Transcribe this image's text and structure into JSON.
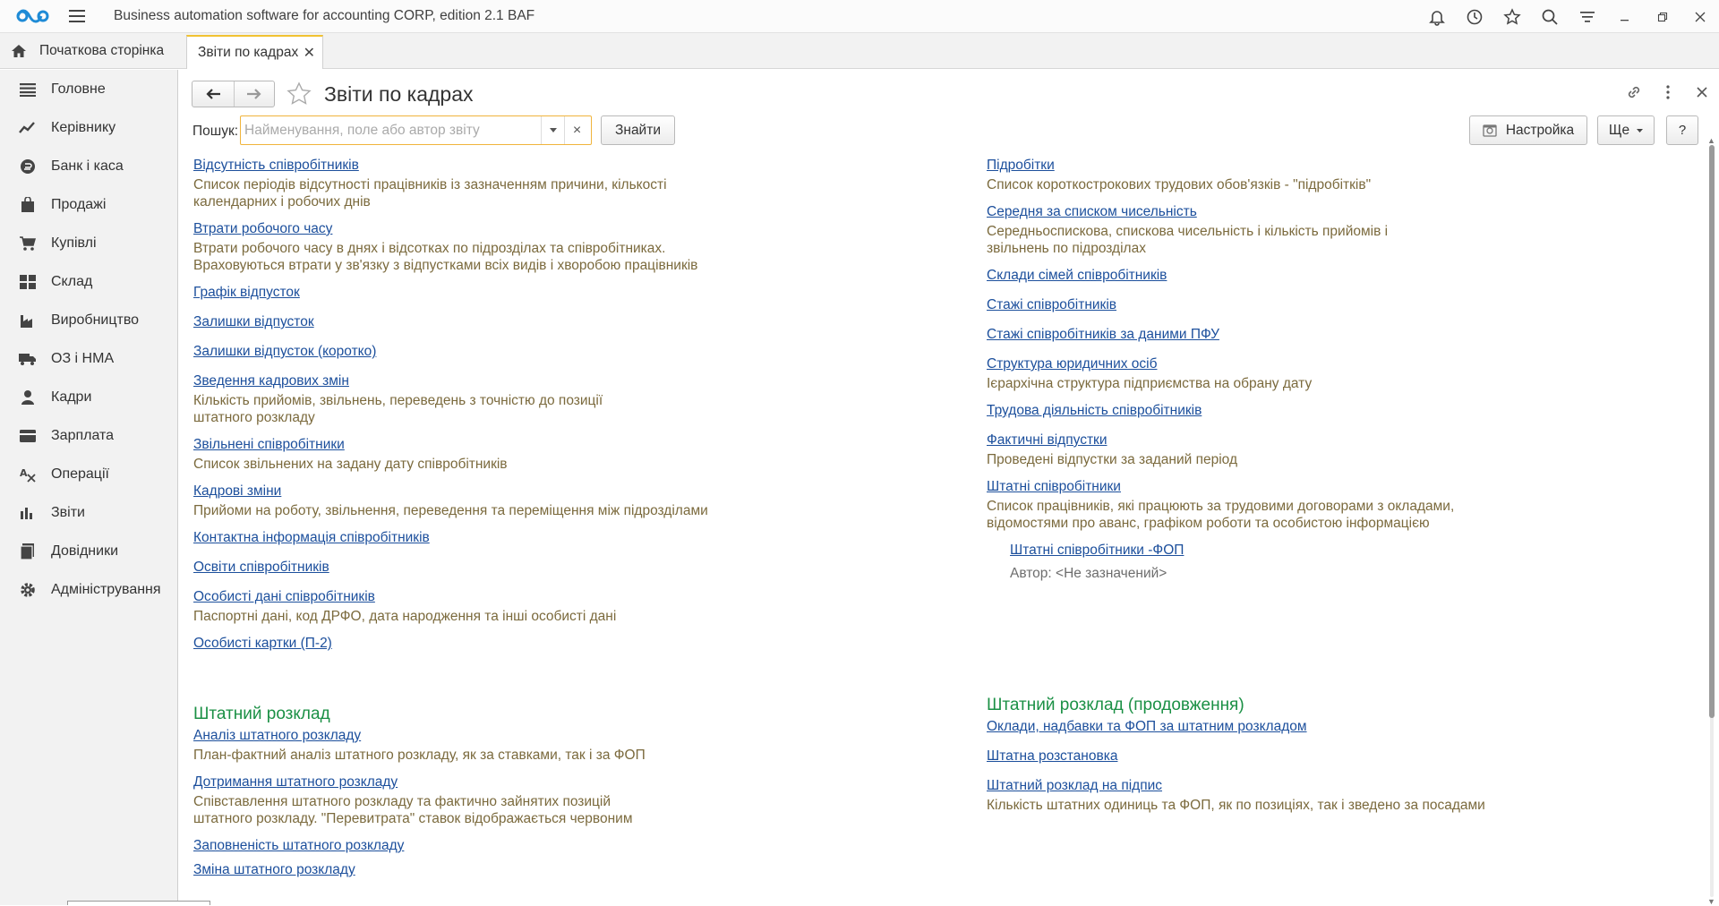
{
  "app": {
    "title": "Business automation software for accounting CORP, edition 2.1 BAF"
  },
  "tabs": {
    "home_label": "Початкова сторінка",
    "active_label": "Звіти по кадрах",
    "close_glyph": "✕"
  },
  "sidebar": {
    "items": [
      {
        "label": "Головне",
        "icon": "list-icon"
      },
      {
        "label": "Керівнику",
        "icon": "trend-icon"
      },
      {
        "label": "Банк і каса",
        "icon": "coin-icon"
      },
      {
        "label": "Продажі",
        "icon": "bag-icon"
      },
      {
        "label": "Купівлі",
        "icon": "cart-icon"
      },
      {
        "label": "Склад",
        "icon": "warehouse-icon"
      },
      {
        "label": "Виробництво",
        "icon": "factory-icon"
      },
      {
        "label": "ОЗ і НМА",
        "icon": "truck-icon"
      },
      {
        "label": "Кадри",
        "icon": "person-icon"
      },
      {
        "label": "Зарплата",
        "icon": "wallet-icon"
      },
      {
        "label": "Операції",
        "icon": "operations-icon"
      },
      {
        "label": "Звіти",
        "icon": "bar-chart-icon"
      },
      {
        "label": "Довідники",
        "icon": "book-icon"
      },
      {
        "label": "Адміністрування",
        "icon": "gear-icon"
      }
    ]
  },
  "form": {
    "title": "Звіти по кадрах",
    "search_label": "Пошук:",
    "search_placeholder": "Найменування, поле або автор звіту",
    "search_value": "",
    "find_button": "Знайти",
    "settings_button": "Настройка",
    "more_button": "Ще",
    "help_button": "?",
    "clear_glyph": "×"
  },
  "reports_left": [
    {
      "title": "Відсутність співробітників",
      "desc": [
        "Список періодів відсутності працівників із зазначенням причини, кількості",
        "календарних і робочих днів"
      ]
    },
    {
      "title": "Втрати робочого часу",
      "desc": [
        "Втрати робочого часу в днях і відсотках по підрозділах та співробітниках.",
        "Враховуються втрати у зв'язку з відпустками всіх видів і хворобою працівників"
      ]
    },
    {
      "title": "Графік відпусток",
      "desc": []
    },
    {
      "title": "Залишки відпусток",
      "desc": []
    },
    {
      "title": "Залишки відпусток (коротко)",
      "desc": []
    },
    {
      "title": "Зведення кадрових змін",
      "desc": [
        "Кількість прийомів, звільнень, переведень з точністю до позиції",
        "штатного розкладу"
      ]
    },
    {
      "title": "Звільнені співробітники",
      "desc": [
        "Список звільнених на задану дату співробітників"
      ]
    },
    {
      "title": "Кадрові зміни",
      "desc": [
        "Прийоми на роботу, звільнення, переведення та переміщення між підрозділами"
      ]
    },
    {
      "title": "Контактна інформація співробітників",
      "desc": []
    },
    {
      "title": "Освіти співробітників",
      "desc": []
    },
    {
      "title": "Особисті дані співробітників",
      "desc": [
        "Паспортні дані, код ДРФО, дата народження та інші особисті дані"
      ]
    },
    {
      "title": "Особисті картки (П-2)",
      "desc": []
    }
  ],
  "reports_right": [
    {
      "title": "Підробітки",
      "desc": [
        "Список короткострокових трудових обов'язків - \"підробітків\""
      ]
    },
    {
      "title": "Середня за списком чисельність",
      "desc": [
        "Середньоспискова, спискова чисельність і кількість прийомів і",
        "звільнень по підрозділах"
      ]
    },
    {
      "title": "Склади сімей співробітників",
      "desc": []
    },
    {
      "title": "Стажі співробітників",
      "desc": []
    },
    {
      "title": "Стажі співробітників за даними ПФУ",
      "desc": []
    },
    {
      "title": "Структура юридичних осіб",
      "desc": [
        "Ієрархічна структура підприємства на обрану дату"
      ]
    },
    {
      "title": "Трудова діяльність співробітників",
      "desc": []
    },
    {
      "title": "Фактичні відпустки",
      "desc": [
        "Проведені відпустки за заданий період"
      ]
    },
    {
      "title": "Штатні співробітники",
      "desc": [
        "Список працівників, які працюють за трудовими договорами з окладами,",
        "відомостями про аванс, графіком роботи та особистою інформацією"
      ]
    }
  ],
  "user_report": {
    "title": "Штатні співробітники -ФОП",
    "author": "Автор: <Не зазначений>"
  },
  "section_left": {
    "title": "Штатний розклад",
    "reports": [
      {
        "title": "Аналіз штатного розкладу",
        "desc": [
          "План-фактний аналіз штатного розкладу, як за ставками, так і за ФОП"
        ]
      },
      {
        "title": "Дотримання штатного розкладу",
        "desc": [
          "Співставлення штатного розкладу та фактично зайнятих позицій",
          "штатного розкладу. \"Перевитрата\" ставок відображається червоним"
        ]
      },
      {
        "title": "Заповненість штатного розкладу",
        "desc": []
      },
      {
        "title": "Зміна штатного розкладу",
        "desc": []
      }
    ]
  },
  "section_right": {
    "title": "Штатний розклад (продовження)",
    "reports": [
      {
        "title": "Оклади, надбавки та ФОП за штатним розкладом",
        "desc": []
      },
      {
        "title": "Штатна розстановка",
        "desc": []
      },
      {
        "title": "Штатний розклад на підпис",
        "desc": [
          "Кількість штатних одиниць та ФОП, як по позиціях, так і зведено за посадами"
        ]
      }
    ]
  },
  "colors": {
    "link": "#1c4f9c",
    "description": "#7b6a3d",
    "section_title": "#1b9045",
    "active_tab_accent": "#f1c232",
    "search_focus": "#f0b43c"
  }
}
